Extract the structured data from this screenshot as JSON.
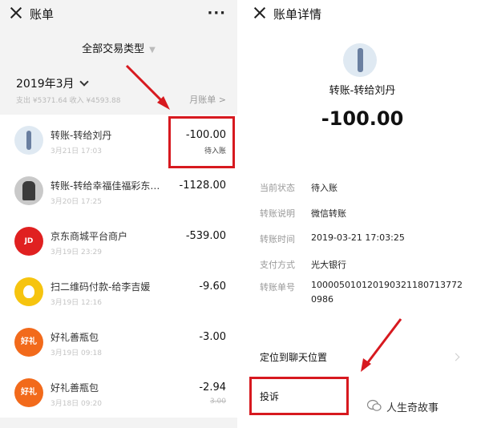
{
  "left": {
    "header": {
      "title": "账单"
    },
    "filter": {
      "label": "全部交易类型"
    },
    "month": "2019年3月",
    "summary": "支出 ¥5371.64 收入 ¥4593.88",
    "monthly_link": "月账单 >",
    "transactions": [
      {
        "title": "转账-转给刘丹",
        "date": "3月21日 17:03",
        "amount": "-100.00",
        "status": "待入账",
        "avatar": "person-avatar"
      },
      {
        "title": "转账-转给幸福佳福彩东…",
        "date": "3月20日 17:25",
        "amount": "-1128.00",
        "status": "",
        "avatar": "photo-avatar"
      },
      {
        "title": "京东商城平台商户",
        "date": "3月19日 23:29",
        "amount": "-539.00",
        "status": "",
        "avatar": "jd-avatar",
        "avatar_text": "JD"
      },
      {
        "title": "扫二维码付款-给李吉媛",
        "date": "3月19日 12:16",
        "amount": "-9.60",
        "status": "",
        "avatar": "yellow-avatar"
      },
      {
        "title": "好礼善瓶包",
        "date": "3月19日 09:18",
        "amount": "-3.00",
        "status": "",
        "avatar": "orange-avatar",
        "avatar_text": "好礼"
      },
      {
        "title": "好礼善瓶包",
        "date": "3月18日 09:20",
        "amount": "-2.94",
        "status": "3.00",
        "avatar": "orange-avatar",
        "avatar_text": "好礼"
      }
    ]
  },
  "right": {
    "header": {
      "title": "账单详情"
    },
    "title": "转账-转给刘丹",
    "amount": "-100.00",
    "fields": [
      {
        "label": "当前状态",
        "value": "待入账"
      },
      {
        "label": "转账说明",
        "value": "微信转账"
      },
      {
        "label": "转账时间",
        "value": "2019-03-21 17:03:25"
      },
      {
        "label": "支付方式",
        "value": "光大银行"
      },
      {
        "label": "转账单号",
        "value": "1000050101201903211807137720986"
      }
    ],
    "actions": {
      "locate": "定位到聊天位置",
      "complaint": "投诉"
    }
  },
  "watermark": "人生奇故事",
  "colors": {
    "highlight": "#d7191f",
    "background": "#f3f3f3"
  }
}
